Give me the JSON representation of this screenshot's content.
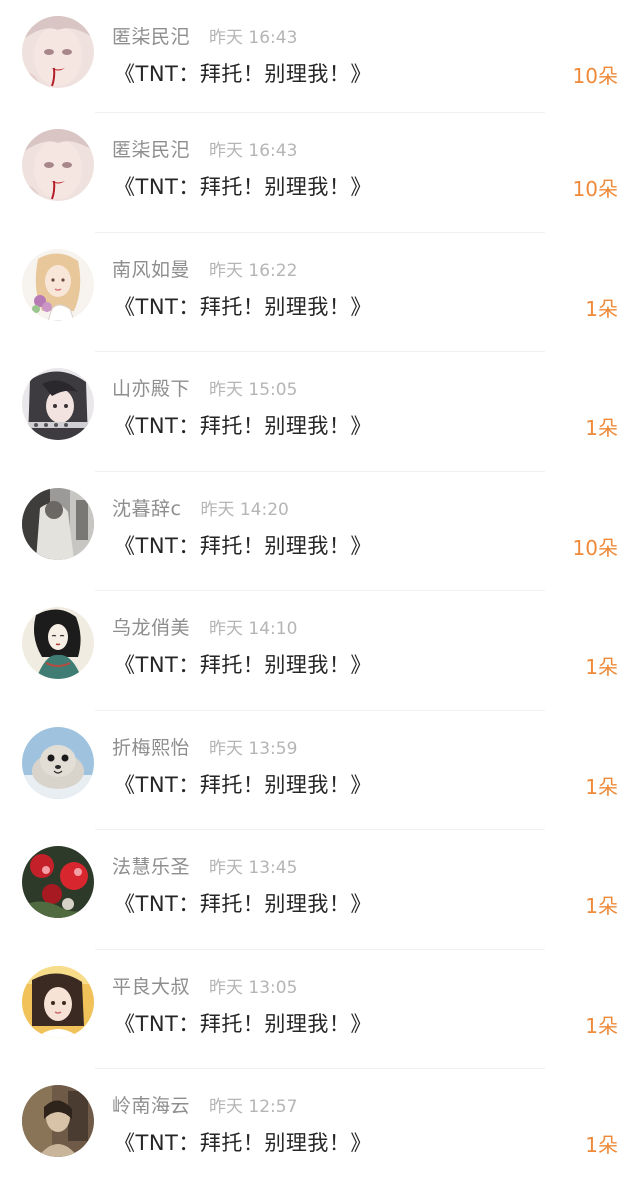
{
  "items": [
    {
      "name": "匿柒民汜",
      "time": "昨天 16:43",
      "title": "《TNT：拜托！别理我！》",
      "count": "10朵",
      "avatar_icon": "avatar-girl-red-lips"
    },
    {
      "name": "匿柒民汜",
      "time": "昨天 16:43",
      "title": "《TNT：拜托！别理我！》",
      "count": "10朵",
      "avatar_icon": "avatar-girl-red-lips"
    },
    {
      "name": "南风如曼",
      "time": "昨天 16:22",
      "title": "《TNT：拜托！别理我！》",
      "count": "1朵",
      "avatar_icon": "avatar-anime-girl-flowers"
    },
    {
      "name": "山亦殿下",
      "time": "昨天 15:05",
      "title": "《TNT：拜托！别理我！》",
      "count": "1朵",
      "avatar_icon": "avatar-girl-dark-hair"
    },
    {
      "name": "沈暮辞c",
      "time": "昨天 14:20",
      "title": "《TNT：拜托！别理我！》",
      "count": "10朵",
      "avatar_icon": "avatar-figure-in-room"
    },
    {
      "name": "乌龙俏美",
      "time": "昨天 14:10",
      "title": "《TNT：拜托！别理我！》",
      "count": "1朵",
      "avatar_icon": "avatar-ink-painting-woman"
    },
    {
      "name": "折梅熙怡",
      "time": "昨天 13:59",
      "title": "《TNT：拜托！别理我！》",
      "count": "1朵",
      "avatar_icon": "avatar-seal"
    },
    {
      "name": "法慧乐圣",
      "time": "昨天 13:45",
      "title": "《TNT：拜托！别理我！》",
      "count": "1朵",
      "avatar_icon": "avatar-red-flowers"
    },
    {
      "name": "平良大叔",
      "time": "昨天 13:05",
      "title": "《TNT：拜托！别理我！》",
      "count": "1朵",
      "avatar_icon": "avatar-girl-photo"
    },
    {
      "name": "岭南海云",
      "time": "昨天 12:57",
      "title": "《TNT：拜托！别理我！》",
      "count": "1朵",
      "avatar_icon": "avatar-vintage-photo"
    }
  ],
  "colors": {
    "count": "#ee8a3a",
    "name": "#8e8e8e",
    "time": "#b5b5b5",
    "title": "#262626"
  }
}
